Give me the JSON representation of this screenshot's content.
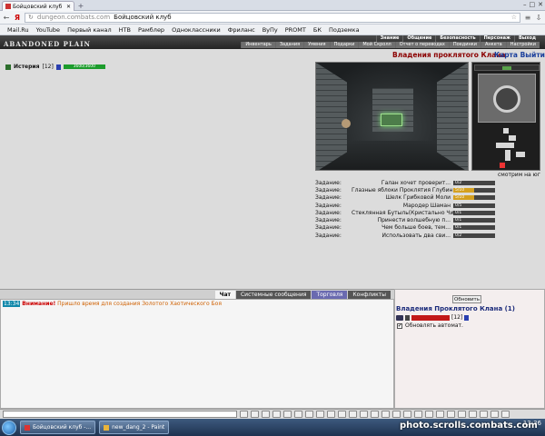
{
  "browser": {
    "tab_title": "Бойцовский клуб",
    "new_tab": "+",
    "address_host": "dungeon.combats.com",
    "address_title": "Бойцовский клуб",
    "window_controls": [
      "–",
      "□",
      "✕"
    ],
    "bookmarks": [
      "Mail.Ru",
      "YouTube",
      "Первый канал",
      "НТВ",
      "Рамблер",
      "Одноклассники",
      "Фриланс",
      "ВуПу",
      "PROMT",
      "БК",
      "Подземка"
    ]
  },
  "game_header": {
    "logo": "ABANDONED PLAIN",
    "menu_top": [
      "Знание",
      "Общение",
      "Безопасность",
      "Персонаж",
      "Выход"
    ],
    "menu_bottom": [
      "Инвентарь",
      "Задания",
      "Умения",
      "Подарки",
      "Мой Скролл",
      "Отчет о переводах",
      "Поединки",
      "Анкета",
      "Настройки"
    ]
  },
  "player": {
    "name": "Истерия",
    "level": "[12]",
    "hp": "3600/3600"
  },
  "clan": {
    "title": "Владения проклятого Клана",
    "exit_label": "Карта Выйти"
  },
  "look_direction": "смотрим на юг",
  "tasks": [
    {
      "label": "Задание:",
      "desc": "Галан хочет проверит...",
      "count": "0/2",
      "progress": 0
    },
    {
      "label": "Задание:",
      "desc": "Глазные яблоки Проклятия Глубин",
      "count": "5/10",
      "progress": 0.5
    },
    {
      "label": "Задание:",
      "desc": "Шелк Грибковой Моли",
      "count": "5/10",
      "progress": 0.5
    },
    {
      "label": "Задание:",
      "desc": "Мародер Шаман",
      "count": "0/5",
      "progress": 0
    },
    {
      "label": "Задание:",
      "desc": "Стеклянная Бутыль(Кристально Чистая)",
      "count": "0/1",
      "progress": 0
    },
    {
      "label": "Задание:",
      "desc": "Принести волшебную п...",
      "count": "0/1",
      "progress": 0
    },
    {
      "label": "Задание:",
      "desc": "Чем больше боев, тем...",
      "count": "0/1",
      "progress": 0
    },
    {
      "label": "Задание:",
      "desc": "Использовать два сви...",
      "count": "0/2",
      "progress": 0
    }
  ],
  "chat": {
    "tabs": [
      "Чат",
      "Системные сообщения",
      "Торговля",
      "Конфликты"
    ],
    "message": {
      "time": "13:34",
      "warning": "Внимание!",
      "text": "Пришло время для создания Золотого Хаотического Боя"
    }
  },
  "right_panel": {
    "refresh_label": "Обновить",
    "title": "Владения Проклятого Клана (1)",
    "member_level": "[12]",
    "auto_refresh_label": "Обновлять автомат.",
    "auto_refresh_check": "✔"
  },
  "taskbar": {
    "items": [
      "Бойцовский клуб -...",
      "new_dang_2 - Paint"
    ],
    "clock": "13:36",
    "watermark": "photo.scrolls.combats.com"
  }
}
